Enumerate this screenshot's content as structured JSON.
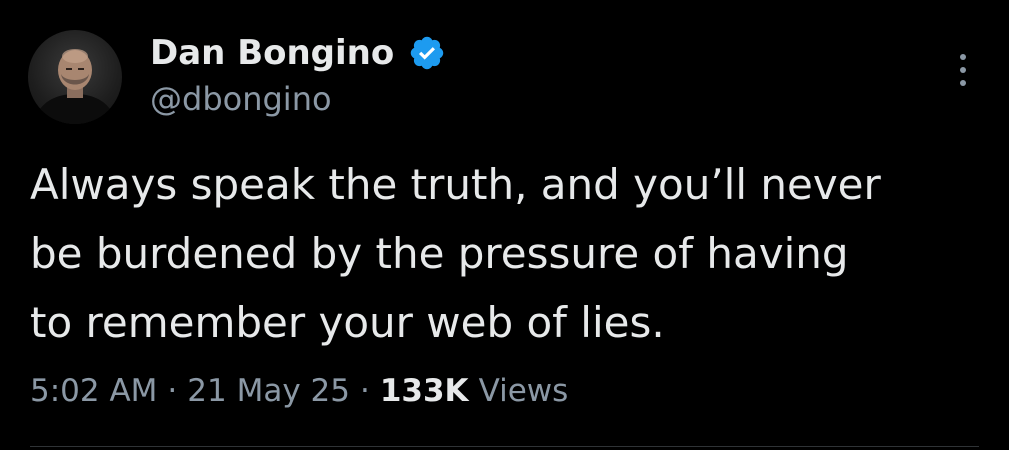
{
  "author": {
    "display_name": "Dan Bongino",
    "handle": "@dbongino",
    "verified": true,
    "avatar_icon": "profile-photo"
  },
  "tweet": {
    "text": "Always speak the truth, and you’ll never\nbe burdened by the pressure of having\nto remember your web of lies.",
    "time": "5:02 AM",
    "separator": "·",
    "date": "21 May 25",
    "views_count": "133K",
    "views_label": "Views"
  },
  "icons": {
    "verified": "verified-badge-icon",
    "more": "more-vertical-icon"
  },
  "colors": {
    "background": "#000000",
    "text_primary": "#e7e9ea",
    "text_secondary": "#8b98a5",
    "verified_blue": "#1d9bf0",
    "divider": "#2f3336"
  }
}
